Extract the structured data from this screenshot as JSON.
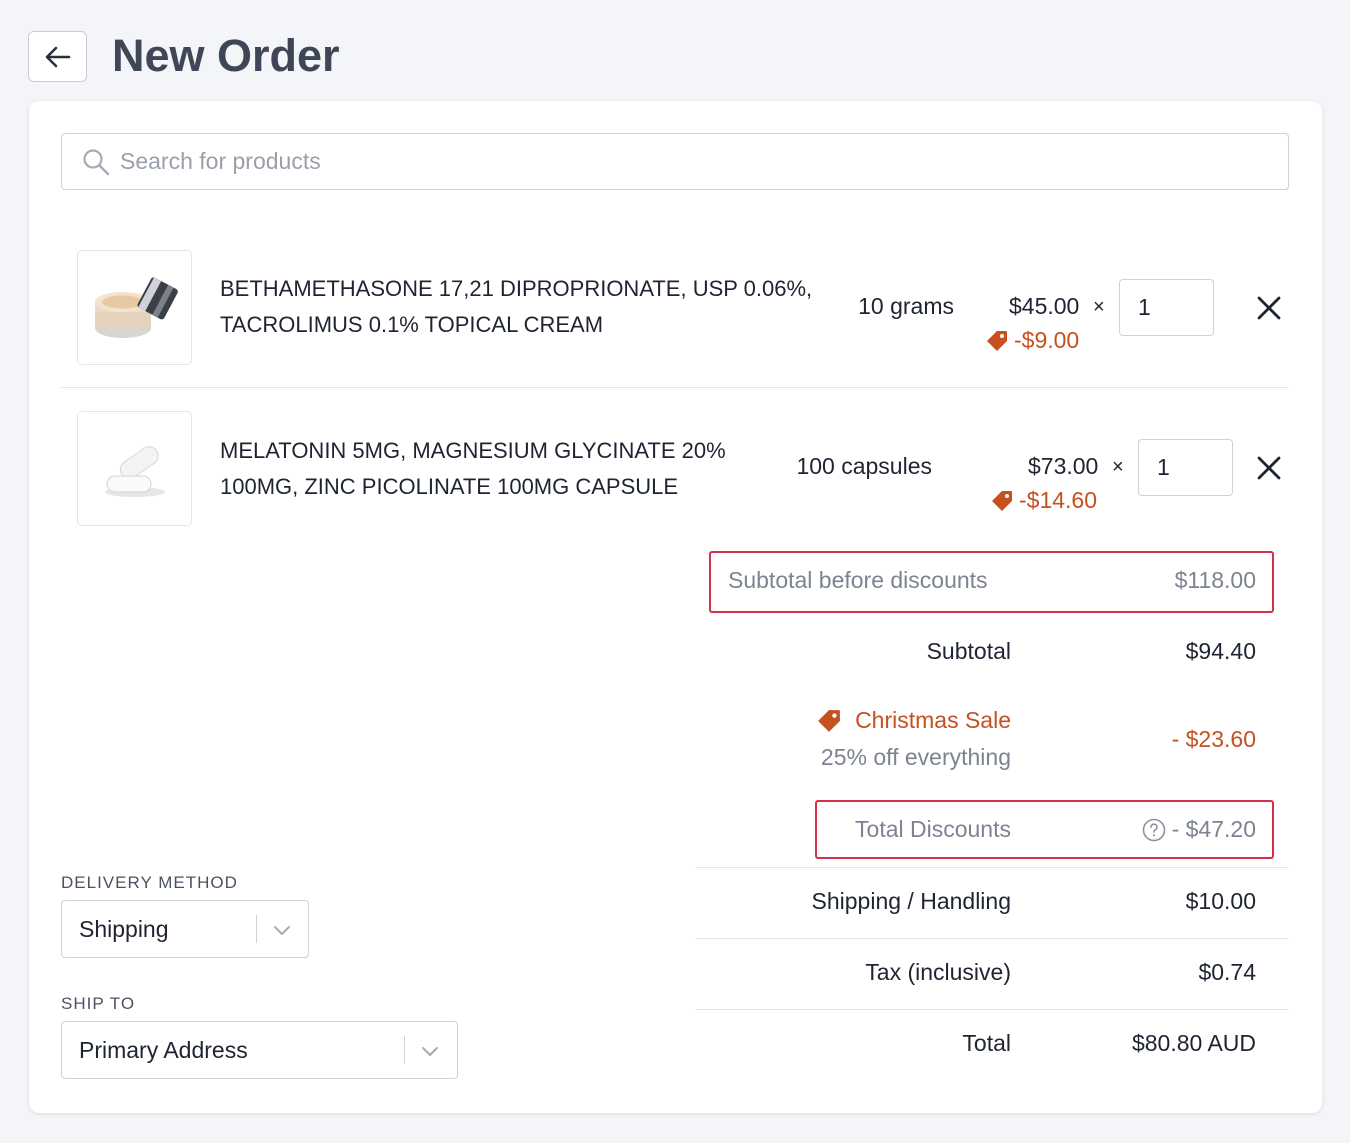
{
  "header": {
    "title": "New Order"
  },
  "search": {
    "placeholder": "Search for products"
  },
  "items": [
    {
      "name_line1": "BETHAMETHASONE 17,21 DIPROPRIONATE, USP 0.06%,",
      "name_line2": "TACROLIMUS 0.1% TOPICAL CREAM",
      "size": "10 grams",
      "price": "$45.00",
      "times": "×",
      "discount": "-$9.00",
      "qty": "1",
      "image": "cream-jar-image"
    },
    {
      "name_line1": "MELATONIN 5MG, MAGNESIUM GLYCINATE 20%",
      "name_line2": "100MG, ZINC PICOLINATE 100MG CAPSULE",
      "size": "100 capsules",
      "price": "$73.00",
      "times": "×",
      "discount": "-$14.60",
      "qty": "1",
      "image": "capsules-image"
    }
  ],
  "summary": {
    "subtotal_before": {
      "label": "Subtotal before discounts",
      "value": "$118.00"
    },
    "subtotal": {
      "label": "Subtotal",
      "value": "$94.40"
    },
    "promo": {
      "name": "Christmas Sale",
      "desc": "25% off everything",
      "value": "- $23.60"
    },
    "total_discounts": {
      "label": "Total Discounts",
      "value": "- $47.20"
    },
    "shipping": {
      "label": "Shipping / Handling",
      "value": "$10.00"
    },
    "tax": {
      "label": "Tax (inclusive)",
      "value": "$0.74"
    },
    "total": {
      "label": "Total",
      "value": "$80.80 AUD"
    }
  },
  "delivery": {
    "method_label": "DELIVERY METHOD",
    "method_value": "Shipping",
    "ship_to_label": "SHIP TO",
    "ship_to_value": "Primary Address"
  },
  "colors": {
    "discount": "#c7501f",
    "highlight_border": "#d4304a",
    "title": "#3f4656"
  },
  "icons": [
    "back-arrow-icon",
    "search-icon",
    "tag-icon",
    "close-icon",
    "help-circle-icon",
    "chevron-down-icon"
  ]
}
